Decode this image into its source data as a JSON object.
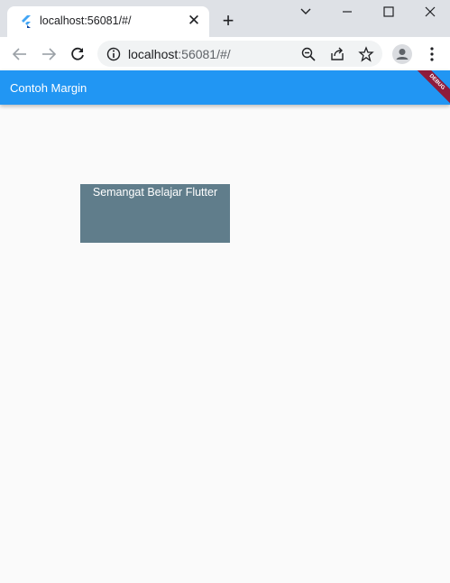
{
  "browser": {
    "tab": {
      "title": "localhost:56081/#/",
      "close_glyph": "✕"
    },
    "new_tab_glyph": "+",
    "address": {
      "host": "localhost",
      "rest": ":56081/#/"
    },
    "icons": {
      "favicon": "flutter-icon",
      "back": "back-arrow-icon",
      "forward": "forward-arrow-icon",
      "reload": "reload-icon",
      "info": "info-icon",
      "zoom": "zoom-icon",
      "share": "share-icon",
      "bookmark": "star-icon",
      "profile": "profile-icon",
      "menu": "kebab-menu-icon"
    }
  },
  "app": {
    "title": "Contoh Margin",
    "debug_banner": "DEBUG",
    "container_text": "Semangat Belajar Flutter",
    "colors": {
      "appbar": "#2196f3",
      "container": "#607d8b",
      "background": "#fafafa"
    }
  }
}
